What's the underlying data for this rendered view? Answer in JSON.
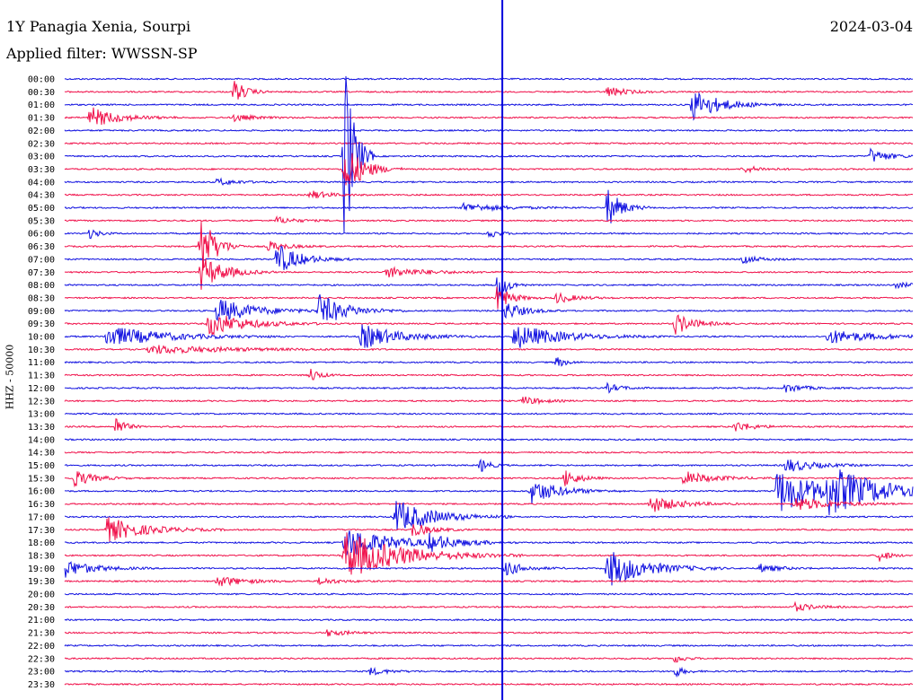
{
  "header": {
    "station": "1Y Panagia Xenia, Sourpi",
    "date": "2024-03-04",
    "filter": "Applied filter: WWSSN-SP",
    "channel": "HHZ - 50000"
  },
  "chart_data": {
    "type": "line",
    "subtype": "helicorder",
    "rows": [
      "00:00",
      "00:30",
      "01:00",
      "01:30",
      "02:00",
      "02:30",
      "03:00",
      "03:30",
      "04:00",
      "04:30",
      "05:00",
      "05:30",
      "06:00",
      "06:30",
      "07:00",
      "07:30",
      "08:00",
      "08:30",
      "09:00",
      "09:30",
      "10:00",
      "10:30",
      "11:00",
      "11:30",
      "12:00",
      "12:30",
      "13:00",
      "13:30",
      "14:00",
      "14:30",
      "15:00",
      "15:30",
      "16:00",
      "16:30",
      "17:00",
      "17:30",
      "18:00",
      "18:30",
      "19:00",
      "19:30",
      "20:00",
      "20:30",
      "21:00",
      "21:30",
      "22:00",
      "22:30",
      "23:00",
      "23:30"
    ],
    "x_range_minutes": [
      0,
      30
    ],
    "colors": {
      "even": "#1010e0",
      "odd": "#f0104a",
      "marker": "#0000dd"
    },
    "current_time_marker_fraction": 0.516,
    "events": [
      {
        "row": 1,
        "x": 0.2,
        "a": 14,
        "w": 0.012
      },
      {
        "row": 1,
        "x": 0.64,
        "a": 6,
        "w": 0.02
      },
      {
        "row": 2,
        "x": 0.74,
        "a": 18,
        "w": 0.03
      },
      {
        "row": 3,
        "x": 0.03,
        "a": 12,
        "w": 0.03
      },
      {
        "row": 3,
        "x": 0.2,
        "a": 4,
        "w": 0.02
      },
      {
        "row": 6,
        "x": 0.33,
        "a": 120,
        "w": 0.01
      },
      {
        "row": 6,
        "x": 0.95,
        "a": 8,
        "w": 0.02
      },
      {
        "row": 7,
        "x": 0.33,
        "a": 30,
        "w": 0.02
      },
      {
        "row": 7,
        "x": 0.8,
        "a": 4,
        "w": 0.02
      },
      {
        "row": 8,
        "x": 0.18,
        "a": 4,
        "w": 0.02
      },
      {
        "row": 9,
        "x": 0.29,
        "a": 5,
        "w": 0.02
      },
      {
        "row": 10,
        "x": 0.64,
        "a": 22,
        "w": 0.015
      },
      {
        "row": 10,
        "x": 0.47,
        "a": 5,
        "w": 0.04
      },
      {
        "row": 11,
        "x": 0.25,
        "a": 4,
        "w": 0.02
      },
      {
        "row": 12,
        "x": 0.03,
        "a": 6,
        "w": 0.01
      },
      {
        "row": 12,
        "x": 0.5,
        "a": 6,
        "w": 0.01
      },
      {
        "row": 13,
        "x": 0.16,
        "a": 40,
        "w": 0.015
      },
      {
        "row": 13,
        "x": 0.24,
        "a": 6,
        "w": 0.02
      },
      {
        "row": 14,
        "x": 0.25,
        "a": 18,
        "w": 0.025
      },
      {
        "row": 14,
        "x": 0.8,
        "a": 4,
        "w": 0.02
      },
      {
        "row": 15,
        "x": 0.16,
        "a": 20,
        "w": 0.025
      },
      {
        "row": 15,
        "x": 0.38,
        "a": 6,
        "w": 0.04
      },
      {
        "row": 16,
        "x": 0.51,
        "a": 20,
        "w": 0.01
      },
      {
        "row": 16,
        "x": 0.98,
        "a": 3,
        "w": 0.02
      },
      {
        "row": 17,
        "x": 0.51,
        "a": 14,
        "w": 0.015
      },
      {
        "row": 17,
        "x": 0.58,
        "a": 6,
        "w": 0.02
      },
      {
        "row": 18,
        "x": 0.18,
        "a": 14,
        "w": 0.04
      },
      {
        "row": 18,
        "x": 0.3,
        "a": 18,
        "w": 0.03
      },
      {
        "row": 18,
        "x": 0.52,
        "a": 10,
        "w": 0.02
      },
      {
        "row": 19,
        "x": 0.17,
        "a": 14,
        "w": 0.04
      },
      {
        "row": 19,
        "x": 0.72,
        "a": 12,
        "w": 0.02
      },
      {
        "row": 20,
        "x": 0.05,
        "a": 12,
        "w": 0.06
      },
      {
        "row": 20,
        "x": 0.35,
        "a": 14,
        "w": 0.04
      },
      {
        "row": 20,
        "x": 0.53,
        "a": 14,
        "w": 0.05
      },
      {
        "row": 20,
        "x": 0.9,
        "a": 8,
        "w": 0.05
      },
      {
        "row": 21,
        "x": 0.1,
        "a": 5,
        "w": 0.08
      },
      {
        "row": 22,
        "x": 0.58,
        "a": 6,
        "w": 0.01
      },
      {
        "row": 23,
        "x": 0.29,
        "a": 8,
        "w": 0.01
      },
      {
        "row": 24,
        "x": 0.64,
        "a": 5,
        "w": 0.015
      },
      {
        "row": 24,
        "x": 0.85,
        "a": 5,
        "w": 0.02
      },
      {
        "row": 25,
        "x": 0.54,
        "a": 5,
        "w": 0.02
      },
      {
        "row": 27,
        "x": 0.06,
        "a": 12,
        "w": 0.01
      },
      {
        "row": 27,
        "x": 0.79,
        "a": 6,
        "w": 0.02
      },
      {
        "row": 30,
        "x": 0.49,
        "a": 8,
        "w": 0.01
      },
      {
        "row": 30,
        "x": 0.85,
        "a": 8,
        "w": 0.03
      },
      {
        "row": 31,
        "x": 0.01,
        "a": 10,
        "w": 0.02
      },
      {
        "row": 31,
        "x": 0.59,
        "a": 10,
        "w": 0.015
      },
      {
        "row": 31,
        "x": 0.73,
        "a": 8,
        "w": 0.03
      },
      {
        "row": 32,
        "x": 0.55,
        "a": 14,
        "w": 0.03
      },
      {
        "row": 32,
        "x": 0.84,
        "a": 26,
        "w": 0.05
      },
      {
        "row": 32,
        "x": 0.9,
        "a": 22,
        "w": 0.06
      },
      {
        "row": 33,
        "x": 0.69,
        "a": 10,
        "w": 0.03
      },
      {
        "row": 33,
        "x": 0.86,
        "a": 8,
        "w": 0.04
      },
      {
        "row": 34,
        "x": 0.39,
        "a": 20,
        "w": 0.04
      },
      {
        "row": 35,
        "x": 0.05,
        "a": 14,
        "w": 0.04
      },
      {
        "row": 35,
        "x": 0.41,
        "a": 8,
        "w": 0.02
      },
      {
        "row": 36,
        "x": 0.33,
        "a": 18,
        "w": 0.05
      },
      {
        "row": 36,
        "x": 0.43,
        "a": 8,
        "w": 0.03
      },
      {
        "row": 37,
        "x": 0.33,
        "a": 28,
        "w": 0.06
      },
      {
        "row": 37,
        "x": 0.96,
        "a": 8,
        "w": 0.01
      },
      {
        "row": 38,
        "x": 0.0,
        "a": 10,
        "w": 0.03
      },
      {
        "row": 38,
        "x": 0.52,
        "a": 8,
        "w": 0.02
      },
      {
        "row": 38,
        "x": 0.64,
        "a": 22,
        "w": 0.04
      },
      {
        "row": 38,
        "x": 0.82,
        "a": 5,
        "w": 0.02
      },
      {
        "row": 39,
        "x": 0.18,
        "a": 6,
        "w": 0.03
      },
      {
        "row": 39,
        "x": 0.3,
        "a": 4,
        "w": 0.02
      },
      {
        "row": 41,
        "x": 0.86,
        "a": 5,
        "w": 0.02
      },
      {
        "row": 43,
        "x": 0.31,
        "a": 4,
        "w": 0.02
      },
      {
        "row": 45,
        "x": 0.72,
        "a": 5,
        "w": 0.01
      },
      {
        "row": 46,
        "x": 0.36,
        "a": 4,
        "w": 0.02
      },
      {
        "row": 46,
        "x": 0.72,
        "a": 6,
        "w": 0.01
      }
    ]
  }
}
